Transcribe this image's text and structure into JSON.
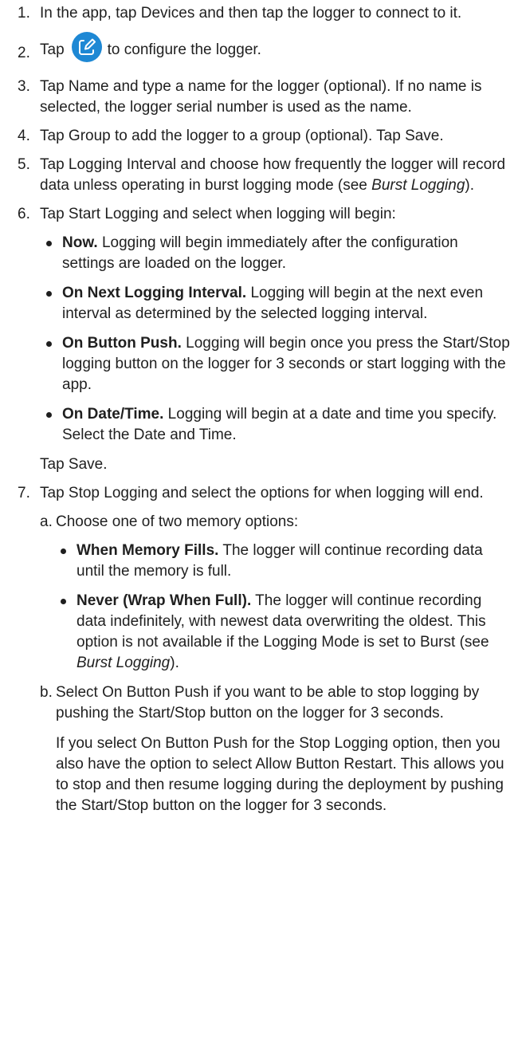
{
  "steps": [
    {
      "num": "1.",
      "text": "In the app, tap Devices and then tap the logger to connect to it."
    },
    {
      "num": "2.",
      "pre": "Tap",
      "post": "to configure the logger.",
      "icon": "edit-icon",
      "icon_color": "#1e88d4"
    },
    {
      "num": "3.",
      "text": "Tap Name and type a name for the logger (optional). If no name is selected, the logger serial number is used as the name."
    },
    {
      "num": "4.",
      "text": "Tap Group to add the logger to a group (optional). Tap Save."
    },
    {
      "num": "5.",
      "text_a": "Tap Logging Interval and choose how frequently the logger will record data unless operating in burst logging mode (see ",
      "link": "Burst Logging",
      "text_b": ")."
    },
    {
      "num": "6.",
      "text": "Tap Start Logging and select when logging will begin:",
      "bullets": [
        {
          "bold": "Now.",
          "text": " Logging will begin immediately after the configuration settings are loaded on the logger."
        },
        {
          "bold": "On Next Logging Interval.",
          "text": " Logging will begin at the next even interval as determined by the selected logging interval."
        },
        {
          "bold": "On Button Push.",
          "text": " Logging will begin once you press the Start/Stop logging button on the logger for 3 seconds or start logging with the app."
        },
        {
          "bold": "On Date/Time.",
          "text": " Logging will begin at a date and time you specify. Select the Date and Time."
        }
      ],
      "after": "Tap Save."
    },
    {
      "num": "7.",
      "text": "Tap Stop Logging and select the options for when logging will end.",
      "sub_a": {
        "letter": "a.",
        "text": "Choose one of two memory options:",
        "bullets": [
          {
            "bold": "When Memory Fills.",
            "text": " The logger will continue recording data until the memory is full."
          },
          {
            "bold": "Never (Wrap When Full).",
            "text": " The logger will continue recording data indefinitely, with newest data overwriting the oldest. This option is not available if the Logging Mode is set to Burst (see ",
            "link": "Burst Logging",
            "text_b": ")."
          }
        ]
      },
      "sub_b": {
        "letter": "b.",
        "text": "Select On Button Push if you want to be able to stop logging by pushing the Start/Stop button on the logger for 3 seconds.",
        "para": "If you select On Button Push for the Stop Logging option, then you also have the option to select Allow Button Restart. This allows you to stop and then resume logging during the deployment by pushing the Start/Stop button on the logger for 3 seconds."
      }
    }
  ]
}
